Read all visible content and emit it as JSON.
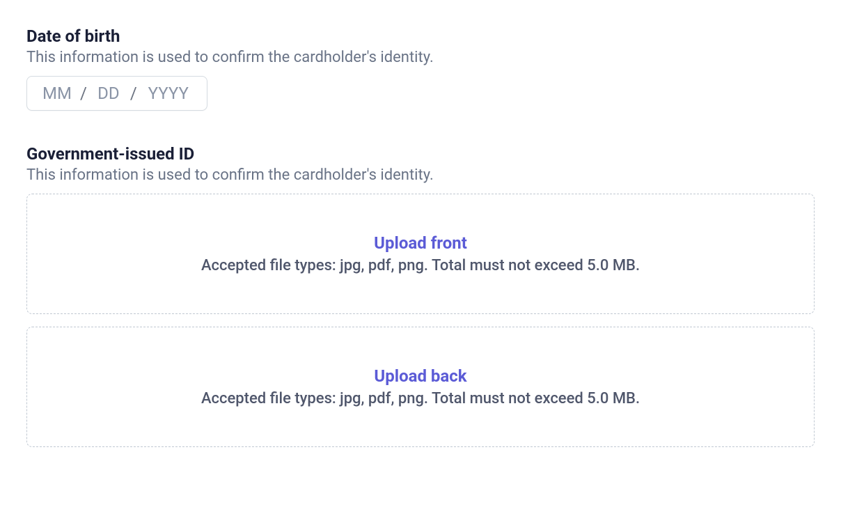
{
  "dob": {
    "title": "Date of birth",
    "desc": "This information is used to confirm the cardholder's identity.",
    "mm_placeholder": "MM",
    "dd_placeholder": "DD",
    "yyyy_placeholder": "YYYY",
    "separator": "/"
  },
  "id": {
    "title": "Government-issued ID",
    "desc": "This information is used to confirm the cardholder's identity.",
    "front": {
      "label": "Upload front",
      "hint": "Accepted file types: jpg, pdf, png. Total must not exceed 5.0 MB."
    },
    "back": {
      "label": "Upload back",
      "hint": "Accepted file types: jpg, pdf, png. Total must not exceed 5.0 MB."
    }
  }
}
